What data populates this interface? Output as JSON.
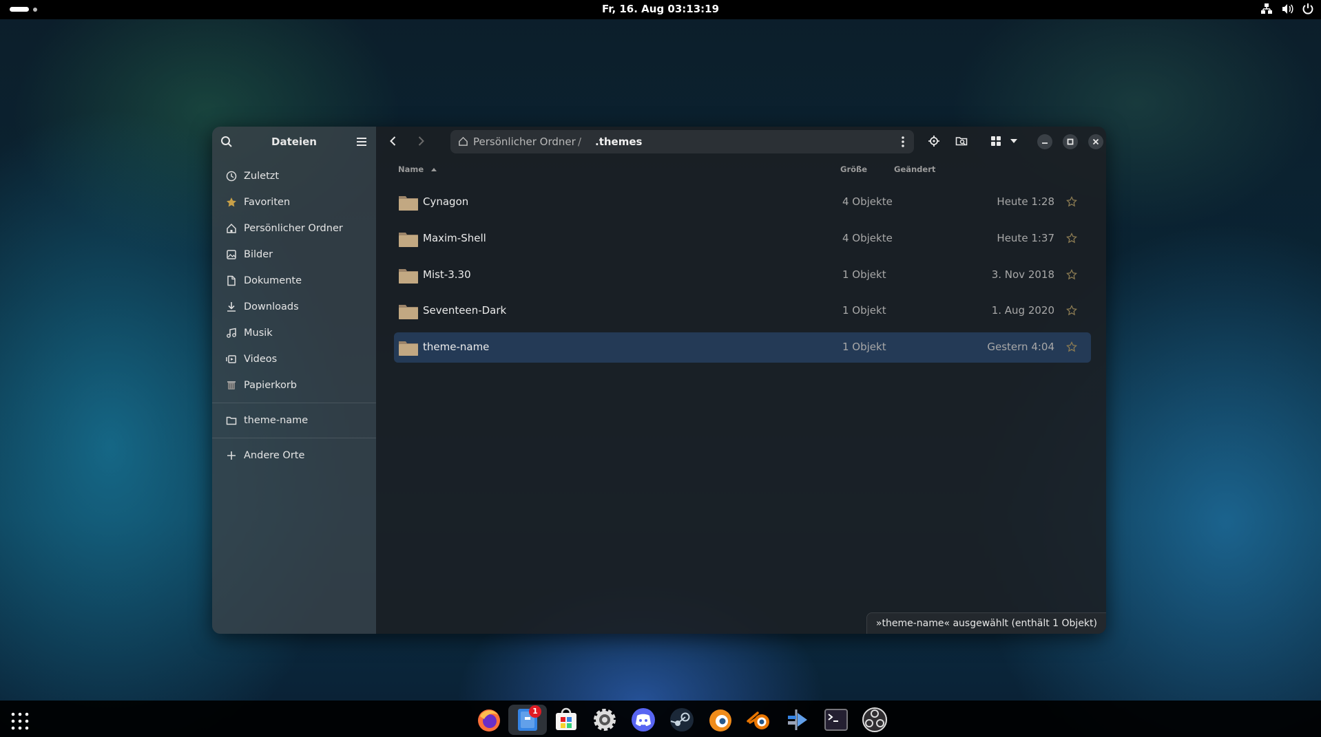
{
  "topbar": {
    "clock": "Fr, 16. Aug  03:13:19"
  },
  "sidebar": {
    "title": "Dateien",
    "items": [
      {
        "label": "Zuletzt",
        "icon": "clock-icon"
      },
      {
        "label": "Favoriten",
        "icon": "star-icon"
      },
      {
        "label": "Persönlicher Ordner",
        "icon": "home-icon"
      },
      {
        "label": "Bilder",
        "icon": "image-icon"
      },
      {
        "label": "Dokumente",
        "icon": "document-icon"
      },
      {
        "label": "Downloads",
        "icon": "download-icon"
      },
      {
        "label": "Musik",
        "icon": "music-icon"
      },
      {
        "label": "Videos",
        "icon": "video-icon"
      },
      {
        "label": "Papierkorb",
        "icon": "trash-icon"
      }
    ],
    "bookmarks": [
      {
        "label": "theme-name",
        "icon": "folder-icon"
      }
    ],
    "other": {
      "label": "Andere Orte",
      "icon": "plus-icon"
    }
  },
  "path": {
    "home": "Persönlicher Ordner",
    "separator": "/",
    "current": ".themes"
  },
  "columns": {
    "name": "Name",
    "size": "Größe",
    "modified": "Geändert"
  },
  "files": [
    {
      "name": "Cynagon",
      "size": "4 Objekte",
      "modified": "Heute 1:28"
    },
    {
      "name": "Maxim-Shell",
      "size": "4 Objekte",
      "modified": "Heute 1:37"
    },
    {
      "name": "Mist-3.30",
      "size": "1 Objekt",
      "modified": "3. Nov 2018"
    },
    {
      "name": "Seventeen-Dark",
      "size": "1 Objekt",
      "modified": "1. Aug 2020"
    },
    {
      "name": "theme-name",
      "size": "1 Objekt",
      "modified": "Gestern 4:04",
      "selected": true
    }
  ],
  "status": "»theme-name« ausgewählt  (enthält 1 Objekt)",
  "dock": {
    "badge": "1",
    "apps": [
      "firefox-icon",
      "files-icon",
      "software-icon",
      "settings-icon",
      "discord-icon",
      "steam-icon",
      "blender-launcher-icon",
      "blender-icon",
      "app-icon",
      "terminal-icon",
      "obs-icon"
    ]
  },
  "colors": {
    "accent": "#243a56",
    "badge": "#e01b24"
  }
}
